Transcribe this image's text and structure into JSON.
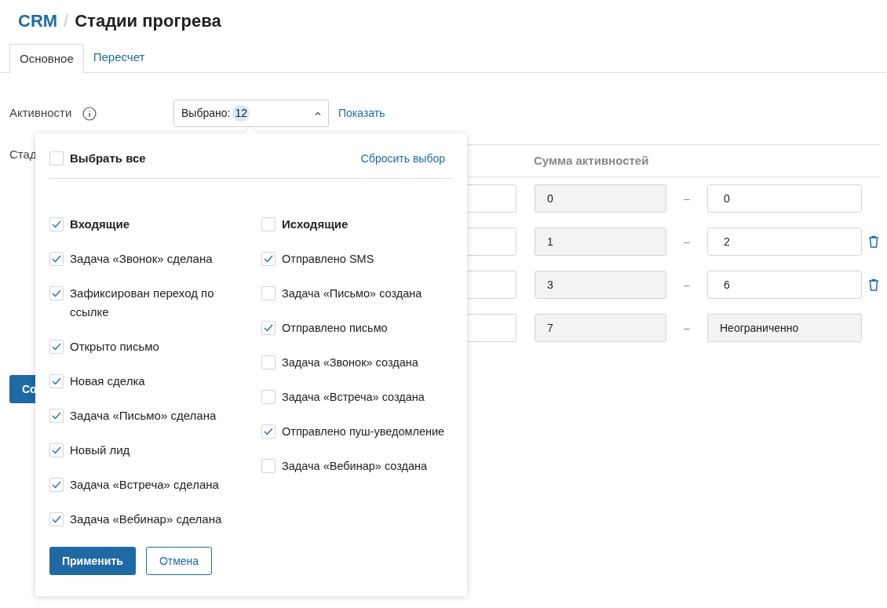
{
  "breadcrumb": {
    "root": "CRM",
    "separator": "/",
    "title": "Стадии прогрева"
  },
  "tabs": [
    {
      "label": "Основное",
      "selected": true
    },
    {
      "label": "Пересчет",
      "selected": false
    }
  ],
  "activities": {
    "label": "Активности",
    "select_prefix": "Выбрано:",
    "select_count": "12",
    "expanded": true,
    "show_link": "Показать"
  },
  "stages": {
    "label": "Стад",
    "sum_header": "Сумма активностей",
    "rows": [
      {
        "from": "0",
        "to": "0",
        "to_disabled": false,
        "deletable": false
      },
      {
        "from": "1",
        "to": "2",
        "to_disabled": false,
        "deletable": true
      },
      {
        "from": "3",
        "to": "6",
        "to_disabled": false,
        "deletable": true
      },
      {
        "from": "7",
        "to": "Неограниченно",
        "to_disabled": true,
        "deletable": false
      }
    ],
    "dash": "–"
  },
  "save_button": "Со",
  "popup": {
    "select_all": {
      "label": "Выбрать все",
      "checked": false
    },
    "reset_link": "Сбросить выбор",
    "groups": [
      {
        "label": "Входящие",
        "checked": true,
        "items": [
          {
            "label": "Задача «Звонок» сделана",
            "checked": true
          },
          {
            "label": "Зафиксирован переход по ссылке",
            "checked": true
          },
          {
            "label": "Открыто письмо",
            "checked": true
          },
          {
            "label": "Новая сделка",
            "checked": true
          },
          {
            "label": "Задача «Письмо» сделана",
            "checked": true
          },
          {
            "label": "Новый лид",
            "checked": true
          },
          {
            "label": "Задача «Встреча» сделана",
            "checked": true
          },
          {
            "label": "Задача «Вебинар» сделана",
            "checked": true
          }
        ]
      },
      {
        "label": "Исходящие",
        "checked": false,
        "items": [
          {
            "label": "Отправлено SMS",
            "checked": true
          },
          {
            "label": "Задача «Письмо» создана",
            "checked": false
          },
          {
            "label": "Отправлено письмо",
            "checked": true
          },
          {
            "label": "Задача «Звонок» создана",
            "checked": false
          },
          {
            "label": "Задача «Встреча» создана",
            "checked": false
          },
          {
            "label": "Отправлено пуш-уведомление",
            "checked": true
          },
          {
            "label": "Задача «Вебинар» создана",
            "checked": false
          }
        ]
      }
    ],
    "apply_button": "Применить",
    "cancel_button": "Отмена"
  }
}
